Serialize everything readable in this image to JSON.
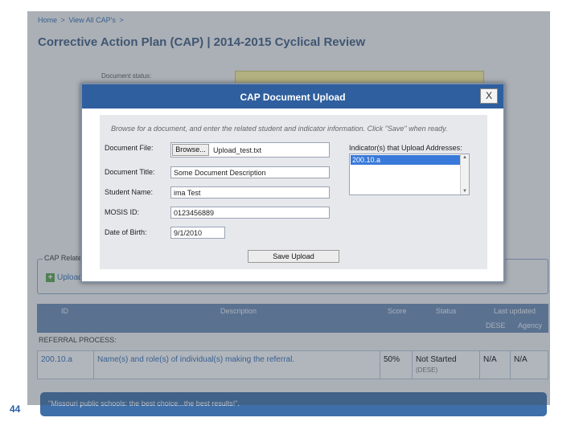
{
  "breadcrumb": [
    "Home",
    ">",
    "View All CAP's",
    ">"
  ],
  "page": {
    "title": "Corrective Action Plan (CAP) | 2014-2015 Cyclical Review",
    "document_status_label": "Document status:"
  },
  "related": {
    "legend": "CAP Related",
    "upload_link": "Upload"
  },
  "table": {
    "headers": [
      "ID",
      "Description",
      "Score",
      "Status",
      "Last updated",
      "DESE",
      "Agency"
    ],
    "section_title": "REFERRAL PROCESS:",
    "rows": [
      {
        "id": "200.10.a",
        "description": "Name(s) and role(s) of individual(s) making the referral.",
        "score": "50%",
        "status": "Not Started",
        "status_sub": "(DESE)",
        "dese": "N/A",
        "agency": "N/A"
      }
    ]
  },
  "footer": {
    "text": "\"Missouri public schools: the best choice...the best results!\"."
  },
  "slide_number": "44",
  "modal": {
    "title": "CAP Document Upload",
    "close_label": "X",
    "instruction": "Browse for a document, and enter the related student and indicator information. Click \"Save\" when ready.",
    "labels": {
      "document_file": "Document File:",
      "document_title": "Document Title:",
      "student_name": "Student Name:",
      "mosis_id": "MOSIS ID:",
      "date_of_birth": "Date of Birth:",
      "indicators": "Indicator(s) that Upload Addresses:"
    },
    "values": {
      "browse_label": "Browse...",
      "file_name": "Upload_test.txt",
      "document_title": "Some Document Description",
      "student_name": "ima Test",
      "mosis_id": "0123456889",
      "date_of_birth": "9/1/2010"
    },
    "indicators": [
      "200.10.a"
    ],
    "save_label": "Save Upload"
  },
  "colors": {
    "header_blue": "#2f5f9e",
    "table_header": "#6a88b3",
    "selected_item": "#3879d9",
    "status_yellow": "#fff59a"
  }
}
